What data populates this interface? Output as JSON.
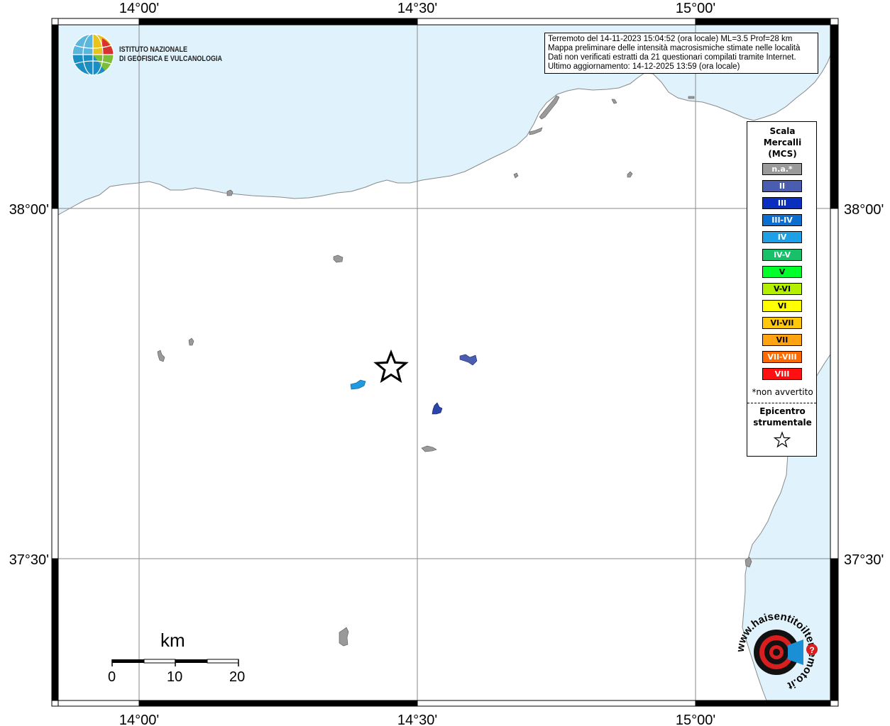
{
  "map": {
    "top_ticks": [
      "14°00'",
      "14°30'",
      "15°00'"
    ],
    "bottom_ticks": [
      "14°00'",
      "14°30'",
      "15°00'"
    ],
    "left_ticks": [
      "38°00'",
      "37°30'"
    ],
    "right_ticks": [
      "38°00'",
      "37°30'"
    ],
    "colors": {
      "sea": "#e0f2fb",
      "land": "#ffffff",
      "grid": "#8a8a8a",
      "frame": "#000000",
      "locality_na": "#9a9a9a",
      "locality_ii": "#4a5db0",
      "locality_iv": "#1e9be0"
    }
  },
  "logos": {
    "ingv_line1": "ISTITUTO NAZIONALE",
    "ingv_line2": "DI GEOFISICA E VULCANOLOGIA",
    "hsc_text": "www.haisentitoilterremoto.it"
  },
  "info": {
    "line1": "Terremoto del 14-11-2023 15:04:52 (ora locale) ML=3.5 Prof=28 km",
    "line2": "Mappa preliminare delle intensità macrosismiche stimate nelle località",
    "line3": "Dati non verificati estratti da 21 questionari compilati tramite Internet.",
    "line4": "Ultimo aggiornamento: 14-12-2025 13:59 (ora locale)"
  },
  "legend": {
    "title": "Scala\nMercalli\n(MCS)",
    "items": [
      {
        "label": "n.a.*",
        "color": "#9a9a9a"
      },
      {
        "label": "II",
        "color": "#4a5db0"
      },
      {
        "label": "III",
        "color": "#0a2fc0"
      },
      {
        "label": "III-IV",
        "color": "#0b6fd2"
      },
      {
        "label": "IV",
        "color": "#1ea0e6"
      },
      {
        "label": "IV-V",
        "color": "#18c06a"
      },
      {
        "label": "V",
        "color": "#00ff2a"
      },
      {
        "label": "V-VI",
        "color": "#b5ef00"
      },
      {
        "label": "VI",
        "color": "#ffff00"
      },
      {
        "label": "VI-VII",
        "color": "#ffc80a"
      },
      {
        "label": "VII",
        "color": "#ffa312"
      },
      {
        "label": "VII-VIII",
        "color": "#ff6a00"
      },
      {
        "label": "VIII",
        "color": "#ff0f0f"
      }
    ],
    "note": "*non avvertito",
    "epicenter": "Epicentro\nstrumentale"
  },
  "scalebar": {
    "unit": "km",
    "labels": [
      "0",
      "10",
      "20"
    ]
  }
}
